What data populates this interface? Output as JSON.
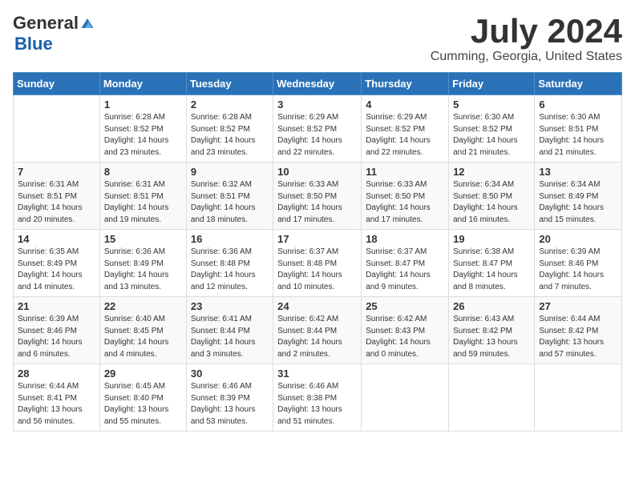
{
  "header": {
    "logo_general": "General",
    "logo_blue": "Blue",
    "month_title": "July 2024",
    "location": "Cumming, Georgia, United States"
  },
  "columns": [
    "Sunday",
    "Monday",
    "Tuesday",
    "Wednesday",
    "Thursday",
    "Friday",
    "Saturday"
  ],
  "weeks": [
    [
      {
        "day": "",
        "info": ""
      },
      {
        "day": "1",
        "info": "Sunrise: 6:28 AM\nSunset: 8:52 PM\nDaylight: 14 hours\nand 23 minutes."
      },
      {
        "day": "2",
        "info": "Sunrise: 6:28 AM\nSunset: 8:52 PM\nDaylight: 14 hours\nand 23 minutes."
      },
      {
        "day": "3",
        "info": "Sunrise: 6:29 AM\nSunset: 8:52 PM\nDaylight: 14 hours\nand 22 minutes."
      },
      {
        "day": "4",
        "info": "Sunrise: 6:29 AM\nSunset: 8:52 PM\nDaylight: 14 hours\nand 22 minutes."
      },
      {
        "day": "5",
        "info": "Sunrise: 6:30 AM\nSunset: 8:52 PM\nDaylight: 14 hours\nand 21 minutes."
      },
      {
        "day": "6",
        "info": "Sunrise: 6:30 AM\nSunset: 8:51 PM\nDaylight: 14 hours\nand 21 minutes."
      }
    ],
    [
      {
        "day": "7",
        "info": "Sunrise: 6:31 AM\nSunset: 8:51 PM\nDaylight: 14 hours\nand 20 minutes."
      },
      {
        "day": "8",
        "info": "Sunrise: 6:31 AM\nSunset: 8:51 PM\nDaylight: 14 hours\nand 19 minutes."
      },
      {
        "day": "9",
        "info": "Sunrise: 6:32 AM\nSunset: 8:51 PM\nDaylight: 14 hours\nand 18 minutes."
      },
      {
        "day": "10",
        "info": "Sunrise: 6:33 AM\nSunset: 8:50 PM\nDaylight: 14 hours\nand 17 minutes."
      },
      {
        "day": "11",
        "info": "Sunrise: 6:33 AM\nSunset: 8:50 PM\nDaylight: 14 hours\nand 17 minutes."
      },
      {
        "day": "12",
        "info": "Sunrise: 6:34 AM\nSunset: 8:50 PM\nDaylight: 14 hours\nand 16 minutes."
      },
      {
        "day": "13",
        "info": "Sunrise: 6:34 AM\nSunset: 8:49 PM\nDaylight: 14 hours\nand 15 minutes."
      }
    ],
    [
      {
        "day": "14",
        "info": "Sunrise: 6:35 AM\nSunset: 8:49 PM\nDaylight: 14 hours\nand 14 minutes."
      },
      {
        "day": "15",
        "info": "Sunrise: 6:36 AM\nSunset: 8:49 PM\nDaylight: 14 hours\nand 13 minutes."
      },
      {
        "day": "16",
        "info": "Sunrise: 6:36 AM\nSunset: 8:48 PM\nDaylight: 14 hours\nand 12 minutes."
      },
      {
        "day": "17",
        "info": "Sunrise: 6:37 AM\nSunset: 8:48 PM\nDaylight: 14 hours\nand 10 minutes."
      },
      {
        "day": "18",
        "info": "Sunrise: 6:37 AM\nSunset: 8:47 PM\nDaylight: 14 hours\nand 9 minutes."
      },
      {
        "day": "19",
        "info": "Sunrise: 6:38 AM\nSunset: 8:47 PM\nDaylight: 14 hours\nand 8 minutes."
      },
      {
        "day": "20",
        "info": "Sunrise: 6:39 AM\nSunset: 8:46 PM\nDaylight: 14 hours\nand 7 minutes."
      }
    ],
    [
      {
        "day": "21",
        "info": "Sunrise: 6:39 AM\nSunset: 8:46 PM\nDaylight: 14 hours\nand 6 minutes."
      },
      {
        "day": "22",
        "info": "Sunrise: 6:40 AM\nSunset: 8:45 PM\nDaylight: 14 hours\nand 4 minutes."
      },
      {
        "day": "23",
        "info": "Sunrise: 6:41 AM\nSunset: 8:44 PM\nDaylight: 14 hours\nand 3 minutes."
      },
      {
        "day": "24",
        "info": "Sunrise: 6:42 AM\nSunset: 8:44 PM\nDaylight: 14 hours\nand 2 minutes."
      },
      {
        "day": "25",
        "info": "Sunrise: 6:42 AM\nSunset: 8:43 PM\nDaylight: 14 hours\nand 0 minutes."
      },
      {
        "day": "26",
        "info": "Sunrise: 6:43 AM\nSunset: 8:42 PM\nDaylight: 13 hours\nand 59 minutes."
      },
      {
        "day": "27",
        "info": "Sunrise: 6:44 AM\nSunset: 8:42 PM\nDaylight: 13 hours\nand 57 minutes."
      }
    ],
    [
      {
        "day": "28",
        "info": "Sunrise: 6:44 AM\nSunset: 8:41 PM\nDaylight: 13 hours\nand 56 minutes."
      },
      {
        "day": "29",
        "info": "Sunrise: 6:45 AM\nSunset: 8:40 PM\nDaylight: 13 hours\nand 55 minutes."
      },
      {
        "day": "30",
        "info": "Sunrise: 6:46 AM\nSunset: 8:39 PM\nDaylight: 13 hours\nand 53 minutes."
      },
      {
        "day": "31",
        "info": "Sunrise: 6:46 AM\nSunset: 8:38 PM\nDaylight: 13 hours\nand 51 minutes."
      },
      {
        "day": "",
        "info": ""
      },
      {
        "day": "",
        "info": ""
      },
      {
        "day": "",
        "info": ""
      }
    ]
  ]
}
